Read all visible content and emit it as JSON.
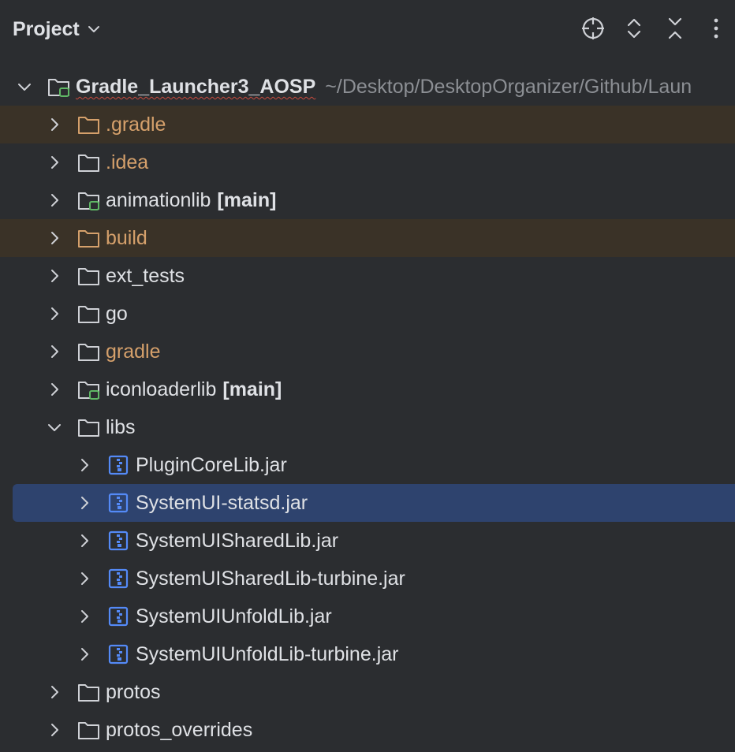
{
  "header": {
    "title": "Project",
    "icons": [
      "locate-icon",
      "expand-collapse-icon",
      "collapse-all-icon",
      "more-options-icon"
    ]
  },
  "tree": {
    "root": {
      "name": "Gradle_Launcher3_AOSP",
      "path": "~/Desktop/DesktopOrganizer/Github/Laun"
    },
    "items": [
      {
        "name": ".gradle"
      },
      {
        "name": ".idea"
      },
      {
        "name": "animationlib",
        "branch": "[main]"
      },
      {
        "name": "build"
      },
      {
        "name": "ext_tests"
      },
      {
        "name": "go"
      },
      {
        "name": "gradle"
      },
      {
        "name": "iconloaderlib",
        "branch": "[main]"
      },
      {
        "name": "libs"
      },
      {
        "name": "PluginCoreLib.jar"
      },
      {
        "name": "SystemUI-statsd.jar"
      },
      {
        "name": "SystemUISharedLib.jar"
      },
      {
        "name": "SystemUISharedLib-turbine.jar"
      },
      {
        "name": "SystemUIUnfoldLib.jar"
      },
      {
        "name": "SystemUIUnfoldLib-turbine.jar"
      },
      {
        "name": "protos"
      },
      {
        "name": "protos_overrides"
      }
    ]
  },
  "colors": {
    "background": "#2b2d30",
    "excluded_row": "#3a3227",
    "selected_row": "#2e436e",
    "excluded_text": "#d5a06b",
    "module_badge": "#5fb865",
    "jar_icon": "#548af7"
  }
}
